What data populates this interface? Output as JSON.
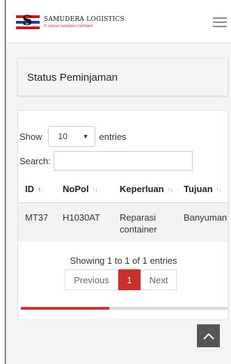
{
  "header": {
    "logo_letter": "S",
    "brand_name": "SAMUDERA LOGISTICS",
    "brand_sub": "PT ANUGAJ SAMUDERA CONTAINER",
    "menu_icon": "hamburger-icon"
  },
  "status_card": {
    "title": "Status Peminjaman"
  },
  "table": {
    "show_label": "Show",
    "entries_label": "entries",
    "page_size": "10",
    "search_label": "Search:",
    "search_value": "",
    "columns": [
      "ID",
      "NoPol",
      "Keperluan",
      "Tujuan"
    ],
    "rows": [
      {
        "id": "MT37",
        "nopol": "H1030AT",
        "keperluan": "Reparasi container",
        "tujuan": "Banyuman"
      }
    ],
    "info": "Showing 1 to 1 of 1 entries",
    "pagination": {
      "previous": "Previous",
      "current": "1",
      "next": "Next"
    },
    "scroll_position": 0.42
  },
  "scroll_top_icon": "chevron-up-icon",
  "colors": {
    "accent": "#c9302c",
    "brand_red": "#c61a1a",
    "brand_blue": "#1f3b8a"
  }
}
